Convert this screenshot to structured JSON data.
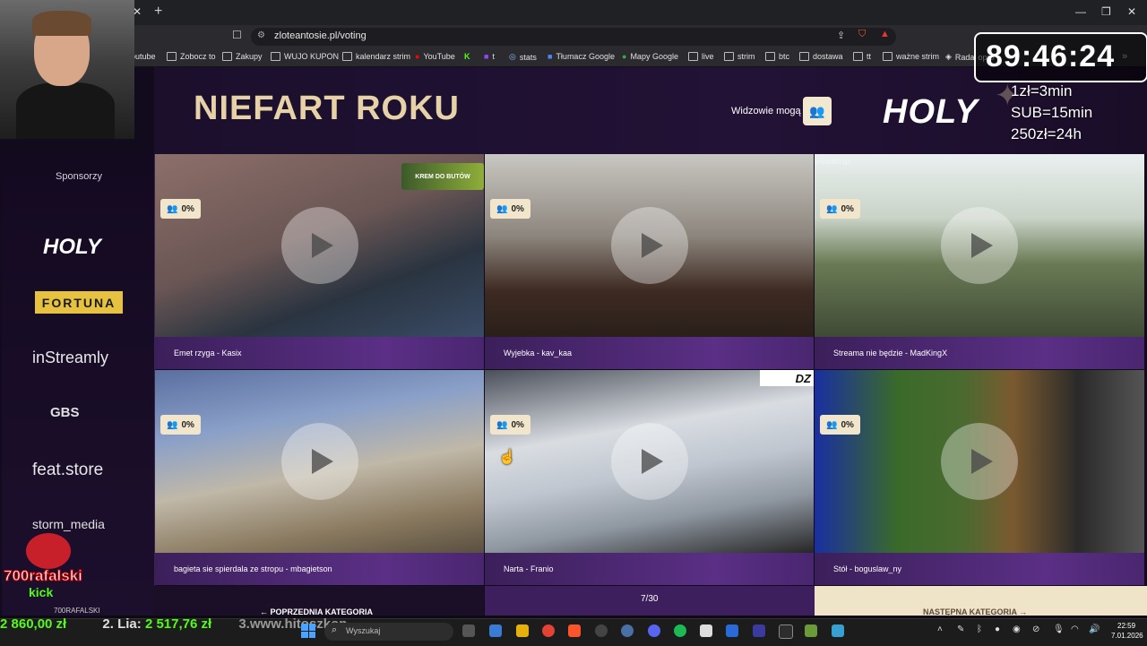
{
  "browser": {
    "url": "zloteantosie.pl/voting",
    "bookmarks": [
      "outube",
      "Zobocz to",
      "Zakupy",
      "WUJO KUPON",
      "kalendarz strim",
      "YouTube",
      "t",
      "stats",
      "Tłumacz Google",
      "Mapy Google",
      "live",
      "strim",
      "btc",
      "dostawa",
      "tt",
      "ważne strim",
      "Rada",
      "opro"
    ]
  },
  "page": {
    "title": "NIEFART ROKU",
    "viewers_label": "Widzowie mogą",
    "header_logo": "HOLY",
    "sponsors_title": "Sponsorzy",
    "sponsors": [
      "HOLY",
      "FORTUNA",
      "inStreamly",
      "GBS",
      "feat.store",
      "storm_media"
    ],
    "cards": [
      {
        "caption": "Emet rzyga - Kasix",
        "percent": "0%"
      },
      {
        "caption": "Wyjebka - kav_kaa",
        "percent": "0%"
      },
      {
        "caption": "Streama nie będzie - MadKingX",
        "percent": "0%",
        "watermark": "v/madkingx"
      },
      {
        "caption": "bagieta sie spierdala ze stropu - mbagietson",
        "percent": "0%"
      },
      {
        "caption": "Narta - Franio",
        "percent": "0%",
        "overlay": "DZ"
      },
      {
        "caption": "Stół - boguslaw_ny",
        "percent": "0%"
      }
    ],
    "card1_ad": "KREM DO BUTÓW",
    "nav": {
      "prev": "POPRZEDNIA KATEGORIA",
      "counter": "7/30",
      "next": "NASTĘPNA KATEGORIA"
    }
  },
  "stream_overlay": {
    "timer": "89:46:24",
    "rules": [
      "1zł=3min",
      "SUB=15min",
      "250zł=24h"
    ],
    "channel": "700rafalski",
    "platform": "kick",
    "sidebar_user": "700RAFALSKI",
    "ticker_amount1": "2 860,00 zł",
    "ticker_label2": "2. Lia:",
    "ticker_amount2": "2 517,76 zł",
    "ticker_www": "3.www.hitoszkon"
  },
  "taskbar": {
    "search_placeholder": "Wyszukaj",
    "time": "22:59",
    "date": "7.01.2026"
  },
  "colors": {
    "accent_gold": "#e6d2a6",
    "card_caption": "#5a2f85",
    "kick_green": "#53fc18"
  }
}
